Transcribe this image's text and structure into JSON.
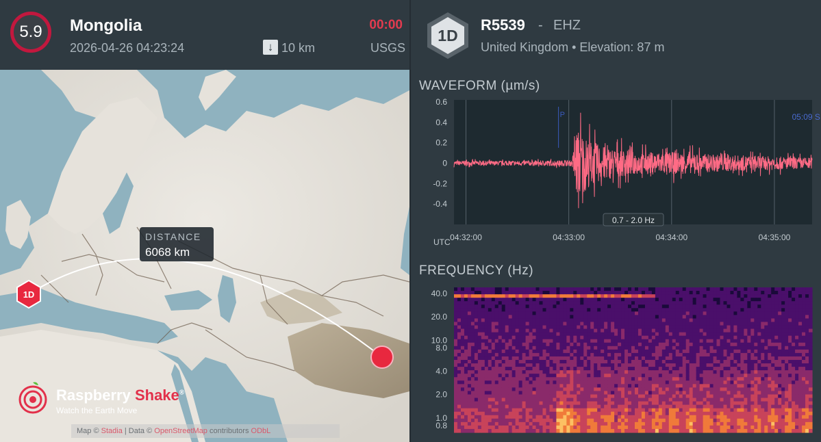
{
  "event": {
    "magnitude": "5.9",
    "region": "Mongolia",
    "datetime": "2026-04-26 04:23:24",
    "depth_icon": "arrow-down-icon",
    "depth": "10 km",
    "timer": "00:00",
    "source": "USGS",
    "magnitude_ring_color": "#c2183e"
  },
  "map": {
    "station_marker": "1D",
    "distance_label": "DISTANCE",
    "distance_value": "6068 km",
    "event_marker_color": "#e8283f",
    "attribution": {
      "map": "Map ©",
      "map_link": "Stadia",
      "sep": "| Data ©",
      "data_link": "OpenStreetMap",
      "contributors": "contributors",
      "license": "ODbL"
    }
  },
  "logo": {
    "name_white": "Raspberry ",
    "name_red": "Shake",
    "reg": "®",
    "tagline": "Watch the Earth Move"
  },
  "station": {
    "badge": "1D",
    "id": "R5539",
    "dash": "-",
    "channel": "EHZ",
    "location": "United Kingdom • Elevation: 87 m"
  },
  "waveform": {
    "title": "WAVEFORM (µm/s)",
    "filter_label": "0.7 - 2.0 Hz",
    "p_marker": "P",
    "s_marker": "05:09  S",
    "utc_label": "UTC",
    "line_color": "#ff6b85"
  },
  "frequency": {
    "title": "FREQUENCY (Hz)"
  },
  "chart_data": [
    {
      "type": "line",
      "title": "WAVEFORM (µm/s)",
      "xlabel": "UTC",
      "ylabel": "",
      "ylim": [
        -0.6,
        0.62
      ],
      "yticks": [
        "0.6",
        "0.4",
        "0.2",
        "0",
        "-0.2",
        "-0.4"
      ],
      "ytick_values": [
        0.6,
        0.4,
        0.2,
        0,
        -0.2,
        -0.4
      ],
      "xlim": [
        "04:31:53",
        "04:35:22"
      ],
      "xticks": [
        "04:32:00",
        "04:33:00",
        "04:34:00",
        "04:35:00"
      ],
      "grid": true,
      "series": [
        {
          "envelope_x": [
            "04:31:53",
            "04:32:20",
            "04:32:50",
            "04:33:02",
            "04:33:04",
            "04:33:07",
            "04:33:10",
            "04:33:20",
            "04:33:40",
            "04:34:00",
            "04:34:30",
            "04:35:00",
            "04:35:22"
          ],
          "envelope_amplitude": [
            0.04,
            0.04,
            0.05,
            0.05,
            0.6,
            0.6,
            0.45,
            0.3,
            0.2,
            0.2,
            0.15,
            0.12,
            0.1
          ]
        }
      ],
      "annotations": [
        {
          "label": "P",
          "x": "04:32:54"
        },
        {
          "label": "05:09  S",
          "x": "04:35:02"
        },
        {
          "label": "0.7 - 2.0 Hz"
        }
      ]
    },
    {
      "type": "heatmap",
      "title": "FREQUENCY (Hz)",
      "ylabel": "Hz",
      "yticks": [
        "40.0",
        "20.0",
        "10.0",
        "8.0",
        "4.0",
        "2.0",
        "1.0",
        "0.8"
      ],
      "ytick_values": [
        40,
        20,
        10,
        8,
        4,
        2,
        1,
        0.8
      ],
      "yscale": "log",
      "xlim": [
        "04:31:53",
        "04:35:22"
      ],
      "colormap": [
        "#1a0a3a",
        "#4a0f6a",
        "#8a2a6a",
        "#c8435a",
        "#f07a3a",
        "#fcc063"
      ]
    }
  ]
}
